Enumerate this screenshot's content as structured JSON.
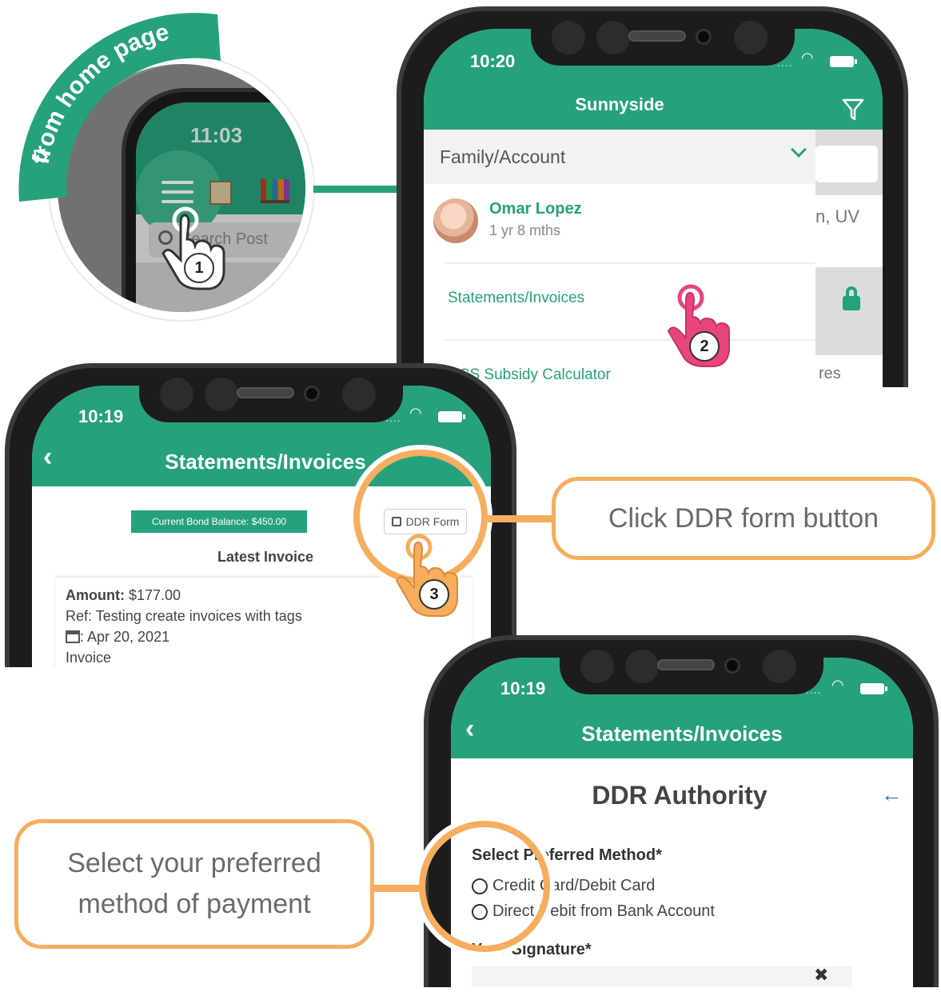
{
  "banner": {
    "label": "from home page"
  },
  "callouts": {
    "ddr": "Click DDR form button",
    "method_line1": "Select your preferred",
    "method_line2": "method of payment"
  },
  "steps": [
    "1",
    "2",
    "3"
  ],
  "phone1": {
    "time": "11:03",
    "search_placeholder": "Search Post"
  },
  "phone2": {
    "time": "10:20",
    "title": "Sunnyside",
    "menu_header": "Family/Account",
    "child_name": "Omar Lopez",
    "child_age": "1 yr 8 mths",
    "items": [
      "Statements/Invoices",
      "CCS Subsidy Calculator"
    ],
    "behind_text_1": "n, UV",
    "behind_text_2": "res"
  },
  "phone3": {
    "time": "10:19",
    "title": "Statements/Invoices",
    "bond_balance": "Current Bond Balance: $450.00",
    "ddr_button": "DDR Form",
    "latest_invoice": "Latest Invoice",
    "amount_label": "Amount:",
    "amount_value": "$177.00",
    "ref": "Ref: Testing create invoices with tags",
    "date": ": Apr 20, 2021",
    "type": "Invoice"
  },
  "phone4": {
    "time": "10:19",
    "title": "Statements/Invoices",
    "heading": "DDR Authority",
    "method_label": "Select Preferred Method*",
    "option1": "Credit Card/Debit Card",
    "option2": "Direct Debit from Bank Account",
    "signature_label": "Your Signature*"
  },
  "colors": {
    "brand": "#26a17d",
    "accent": "#f6ad5d",
    "pink": "#e8457e"
  }
}
